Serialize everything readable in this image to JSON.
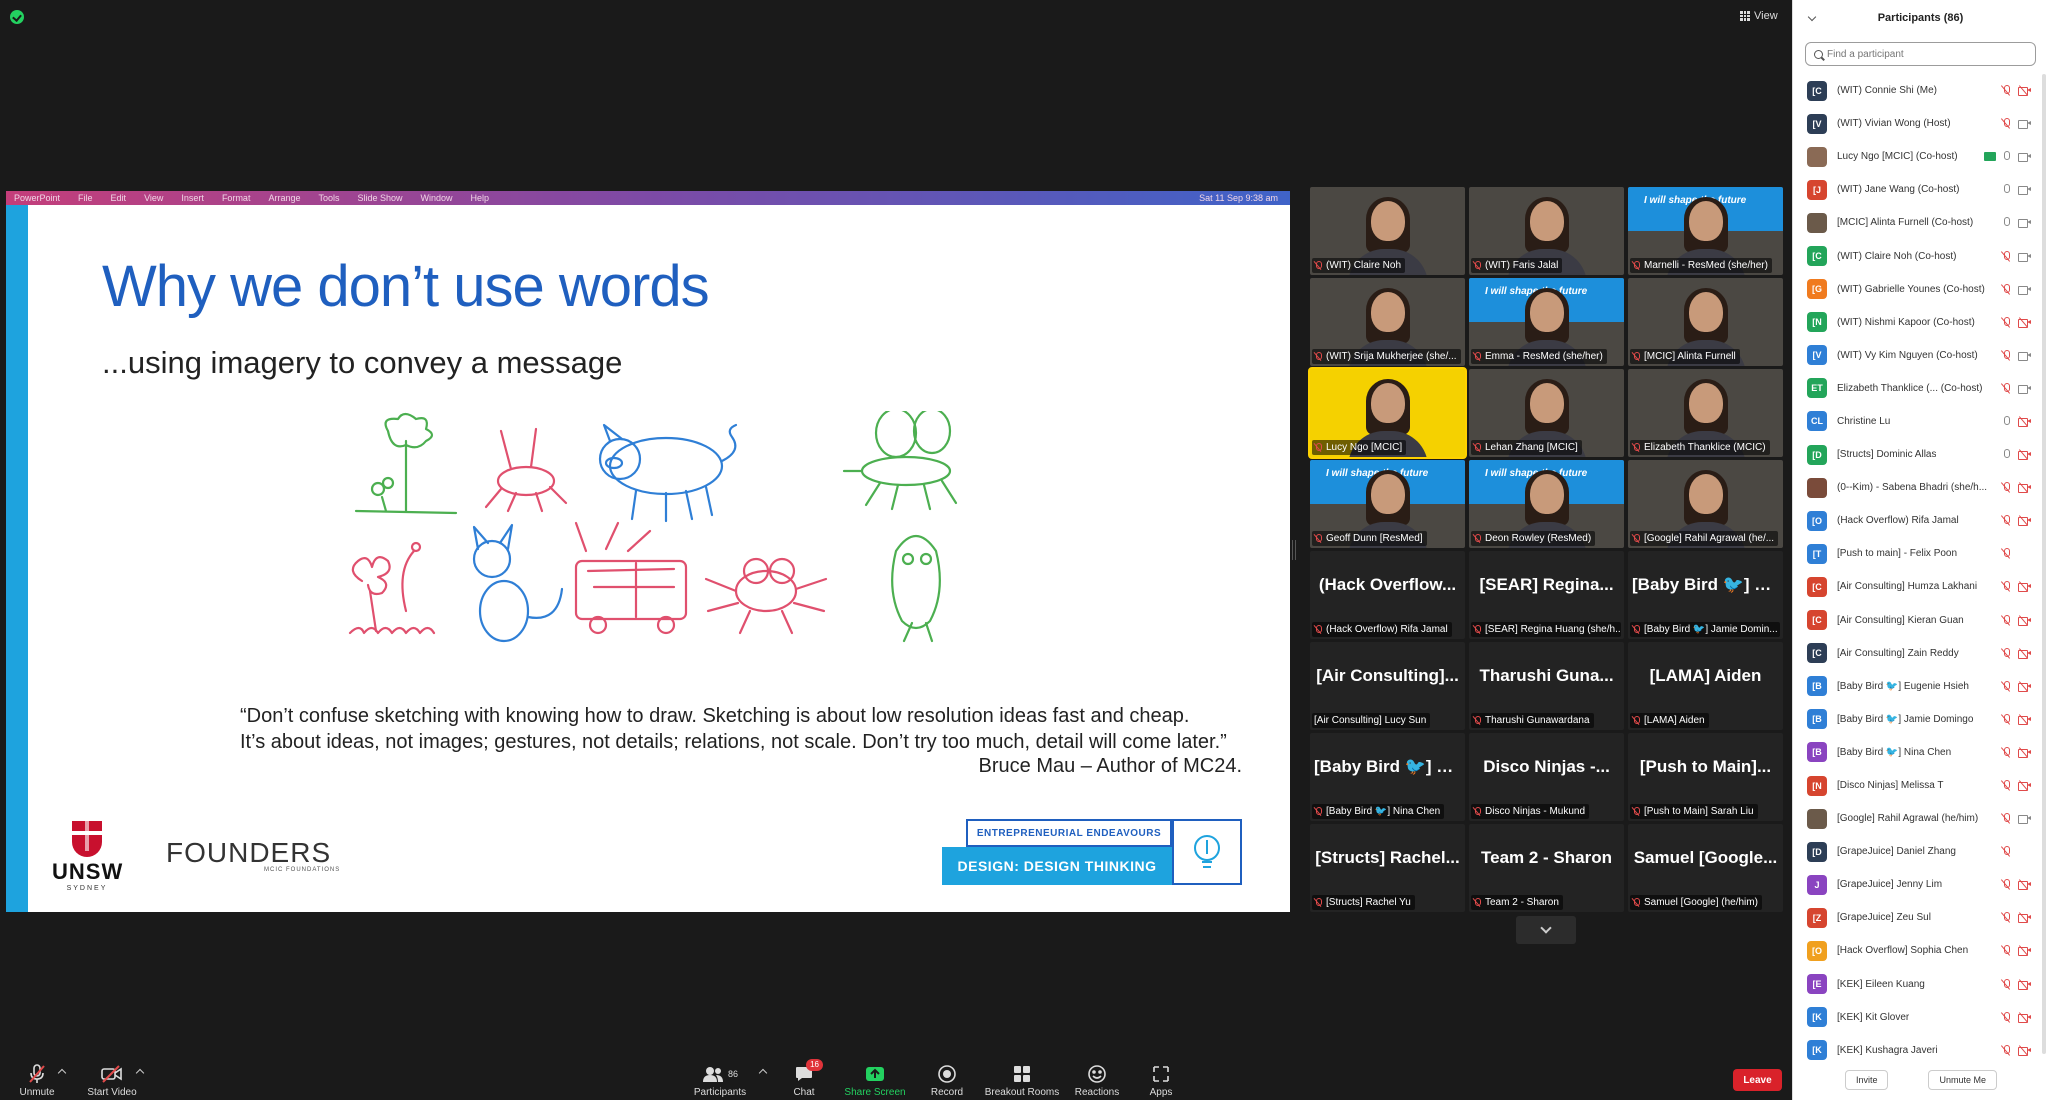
{
  "top": {
    "view_label": "View"
  },
  "slide": {
    "menubar": [
      "PowerPoint",
      "File",
      "Edit",
      "View",
      "Insert",
      "Format",
      "Arrange",
      "Tools",
      "Slide Show",
      "Window",
      "Help"
    ],
    "menubar_clock": "Sat 11 Sep  9:38 am",
    "title": "Why we don’t use words",
    "subtitle": "...using imagery to convey a message",
    "quote_line1": "“Don’t confuse sketching with knowing how to draw. Sketching is about low resolution ideas fast and cheap.",
    "quote_line2": "It’s about ideas, not images; gestures, not details; relations, not scale. Don’t try too much, detail will come later.”",
    "quote_author": "Bruce Mau – Author of MC24.",
    "unsw_text": "UNSW",
    "unsw_sub": "SYDNEY",
    "founders_text": "FOUNDERS",
    "founders_sub": "MCIC FOUNDATIONS",
    "ee_label": "ENTREPRENEURIAL ENDEAVOURS",
    "dt_label": "DESIGN: DESIGN THINKING",
    "sketch_colors": {
      "green": "#4caf50",
      "pink": "#e0506e",
      "blue": "#2f7fd6"
    }
  },
  "tiles": [
    {
      "type": "video",
      "name": "(WIT) Claire Noh"
    },
    {
      "type": "video",
      "name": "(WIT) Faris Jalal"
    },
    {
      "type": "banner",
      "banner": "I will shape the future",
      "name": "Marnelli - ResMed (she/her)"
    },
    {
      "type": "video",
      "name": "(WIT) Srija Mukherjee (she/..."
    },
    {
      "type": "banner",
      "banner": "I will shape the future",
      "name": "Emma - ResMed (she/her)"
    },
    {
      "type": "video",
      "name": "[MCIC] Alinta Furnell"
    },
    {
      "type": "active",
      "name": "Lucy Ngo [MCIC]"
    },
    {
      "type": "video",
      "name": "Lehan Zhang [MCIC]"
    },
    {
      "type": "video",
      "name": "Elizabeth Thanklice (MCIC)"
    },
    {
      "type": "banner",
      "banner": "I will shape the future",
      "name": "Geoff Dunn [ResMed]"
    },
    {
      "type": "banner",
      "banner": "I will shape the future",
      "name": "Deon Rowley (ResMed)"
    },
    {
      "type": "video",
      "name": "[Google] Rahil Agrawal (he/..."
    },
    {
      "type": "name",
      "big": "(Hack Overflow...",
      "name": "(Hack Overflow) Rifa Jamal"
    },
    {
      "type": "name",
      "big": "[SEAR] Regina...",
      "name": "[SEAR] Regina Huang (she/h..."
    },
    {
      "type": "name",
      "big": "[Baby Bird 🐦] Ja...",
      "name": "[Baby Bird 🐦] Jamie Domin..."
    },
    {
      "type": "name",
      "big": "[Air Consulting]...",
      "name": "[Air Consulting] Lucy Sun",
      "unmuted": true
    },
    {
      "type": "name",
      "big": "Tharushi Guna...",
      "name": "Tharushi Gunawardana"
    },
    {
      "type": "name",
      "big": "[LAMA] Aiden",
      "name": "[LAMA] Aiden"
    },
    {
      "type": "name",
      "big": "[Baby Bird 🐦] N...",
      "name": "[Baby Bird 🐦] Nina Chen"
    },
    {
      "type": "name",
      "big": "Disco Ninjas -...",
      "name": "Disco Ninjas - Mukund"
    },
    {
      "type": "name",
      "big": "[Push to Main]...",
      "name": "[Push to Main] Sarah Liu"
    },
    {
      "type": "name",
      "big": "[Structs] Rachel...",
      "name": "[Structs] Rachel Yu"
    },
    {
      "type": "name",
      "big": "Team 2 - Sharon",
      "name": "Team 2 - Sharon"
    },
    {
      "type": "name",
      "big": "Samuel [Google...",
      "name": "Samuel [Google] (he/him)"
    }
  ],
  "toolbar": {
    "unmute": "Unmute",
    "start_video": "Start Video",
    "participants": "Participants",
    "participants_count": "86",
    "chat": "Chat",
    "chat_badge": "16",
    "share_screen": "Share Screen",
    "record": "Record",
    "breakout": "Breakout Rooms",
    "reactions": "Reactions",
    "apps": "Apps",
    "leave": "Leave"
  },
  "panel": {
    "title": "Participants (86)",
    "search_placeholder": "Find a participant",
    "invite": "Invite",
    "unmute_me": "Unmute Me",
    "participants": [
      {
        "initials": "[C",
        "color": "#2d3e56",
        "name": "(WIT) Connie Shi (Me)",
        "mic": "muted",
        "cam": "off"
      },
      {
        "initials": "[V",
        "color": "#2d3e56",
        "name": "(WIT) Vivian Wong (Host)",
        "mic": "muted",
        "cam": "on"
      },
      {
        "initials": "",
        "color": "#8a6a55",
        "name": "Lucy Ngo [MCIC] (Co-host)",
        "mic": "on",
        "cam": "on",
        "share": true
      },
      {
        "initials": "[J",
        "color": "#d6452f",
        "name": "(WIT) Jane Wang (Co-host)",
        "mic": "on",
        "cam": "on"
      },
      {
        "initials": "",
        "color": "#6b5a4a",
        "name": "[MCIC] Alinta Furnell (Co-host)",
        "mic": "on",
        "cam": "on"
      },
      {
        "initials": "[C",
        "color": "#23a55a",
        "name": "(WIT) Claire Noh (Co-host)",
        "mic": "muted",
        "cam": "on"
      },
      {
        "initials": "[G",
        "color": "#f07b1f",
        "name": "(WIT) Gabrielle Younes (Co-host)",
        "mic": "muted",
        "cam": "on"
      },
      {
        "initials": "[N",
        "color": "#23a55a",
        "name": "(WIT) Nishmi Kapoor (Co-host)",
        "mic": "muted",
        "cam": "off"
      },
      {
        "initials": "[V",
        "color": "#2f7fd6",
        "name": "(WIT) Vy Kim Nguyen (Co-host)",
        "mic": "muted",
        "cam": "on"
      },
      {
        "initials": "ET",
        "color": "#23a55a",
        "name": "Elizabeth Thanklice (...   (Co-host)",
        "mic": "muted",
        "cam": "on"
      },
      {
        "initials": "CL",
        "color": "#2f7fd6",
        "name": "Christine Lu",
        "mic": "on",
        "cam": "off"
      },
      {
        "initials": "[D",
        "color": "#23a55a",
        "name": "[Structs] Dominic Allas",
        "mic": "on",
        "cam": "off"
      },
      {
        "initials": "",
        "color": "#7a4b3a",
        "name": "(0--Kim) - Sabena Bhadri (she/h...",
        "mic": "muted",
        "cam": "off"
      },
      {
        "initials": "[O",
        "color": "#2f7fd6",
        "name": "(Hack Overflow) Rifa Jamal",
        "mic": "muted",
        "cam": "off"
      },
      {
        "initials": "[T",
        "color": "#2f7fd6",
        "name": "[Push to main] - Felix Poon",
        "mic": "muted",
        "cam": "none"
      },
      {
        "initials": "[C",
        "color": "#d6452f",
        "name": "[Air Consulting] Humza Lakhani",
        "mic": "muted",
        "cam": "off"
      },
      {
        "initials": "[C",
        "color": "#d6452f",
        "name": "[Air Consulting] Kieran Guan",
        "mic": "muted",
        "cam": "off"
      },
      {
        "initials": "[C",
        "color": "#2d3e56",
        "name": "[Air Consulting] Zain Reddy",
        "mic": "muted",
        "cam": "off"
      },
      {
        "initials": "[B",
        "color": "#2f7fd6",
        "name": "[Baby Bird 🐦] Eugenie Hsieh",
        "mic": "muted",
        "cam": "off"
      },
      {
        "initials": "[B",
        "color": "#2f7fd6",
        "name": "[Baby Bird 🐦] Jamie Domingo",
        "mic": "muted",
        "cam": "off"
      },
      {
        "initials": "[B",
        "color": "#8a44c0",
        "name": "[Baby Bird 🐦] Nina Chen",
        "mic": "muted",
        "cam": "off"
      },
      {
        "initials": "[N",
        "color": "#d6452f",
        "name": "[Disco Ninjas] Melissa T",
        "mic": "muted",
        "cam": "off"
      },
      {
        "initials": "",
        "color": "#6b5a4a",
        "name": "[Google] Rahil Agrawal (he/him)",
        "mic": "muted",
        "cam": "on"
      },
      {
        "initials": "[D",
        "color": "#2d3e56",
        "name": "[GrapeJuice] Daniel Zhang",
        "mic": "muted",
        "cam": "none"
      },
      {
        "initials": "J",
        "color": "#8a44c0",
        "name": "[GrapeJuice] Jenny Lim",
        "mic": "muted",
        "cam": "off"
      },
      {
        "initials": "[Z",
        "color": "#d6452f",
        "name": "[GrapeJuice] Zeu Sul",
        "mic": "muted",
        "cam": "off"
      },
      {
        "initials": "[O",
        "color": "#f0a01f",
        "name": "[Hack Overflow] Sophia Chen",
        "mic": "muted",
        "cam": "off"
      },
      {
        "initials": "[E",
        "color": "#8a44c0",
        "name": "[KEK] Eileen Kuang",
        "mic": "muted",
        "cam": "off"
      },
      {
        "initials": "[K",
        "color": "#2f7fd6",
        "name": "[KEK] Kit Glover",
        "mic": "muted",
        "cam": "off"
      },
      {
        "initials": "[K",
        "color": "#2f7fd6",
        "name": "[KEK] Kushagra Javeri",
        "mic": "muted",
        "cam": "off"
      }
    ]
  }
}
